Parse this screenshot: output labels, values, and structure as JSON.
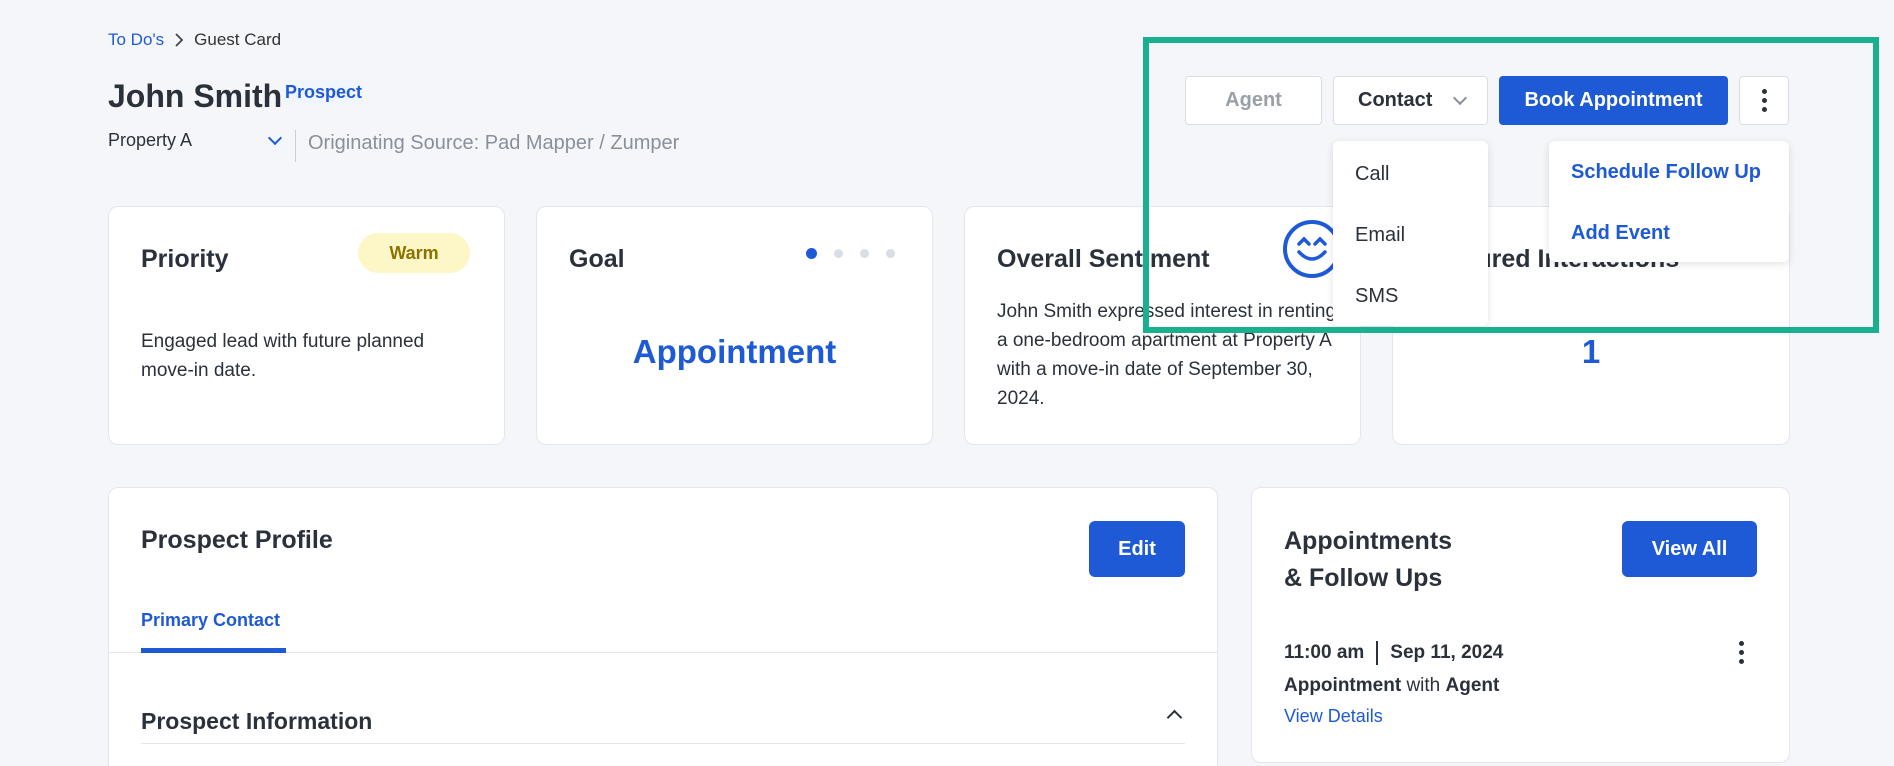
{
  "breadcrumb": {
    "parent": "To Do's",
    "current": "Guest Card"
  },
  "header": {
    "name": "John Smith",
    "status_badge": "Prospect",
    "property": "Property A",
    "originating_source": "Originating Source: Pad Mapper / Zumper"
  },
  "actions": {
    "agent": "Agent",
    "contact": "Contact",
    "book": "Book Appointment"
  },
  "contact_menu": {
    "items": [
      "Call",
      "Email",
      "SMS"
    ]
  },
  "more_menu": {
    "items": [
      "Schedule Follow Up",
      "Add Event"
    ]
  },
  "cards": {
    "priority": {
      "title": "Priority",
      "badge": "Warm",
      "body": "Engaged lead with future planned move-in date."
    },
    "goal": {
      "title": "Goal",
      "value": "Appointment",
      "steps_total": 4,
      "current_step": 1
    },
    "sentiment": {
      "title": "Overall Sentiment",
      "body": "John Smith expressed interest in renting a one-bedroom apartment at Property A with a move-in date of September 30, 2024."
    },
    "interactions": {
      "title": "Featured Interactions",
      "value": "1"
    }
  },
  "profile": {
    "title": "Prospect Profile",
    "edit": "Edit",
    "tab": "Primary Contact",
    "section": "Prospect Information"
  },
  "appointments": {
    "title_line1": "Appointments",
    "title_line2": "& Follow Ups",
    "view_all": "View All",
    "item": {
      "time": "11:00 am",
      "date": "Sep 11, 2024",
      "type": "Appointment",
      "with_word": "with",
      "with": "Agent",
      "link": "View Details"
    }
  },
  "colors": {
    "accent": "#1e5ad6",
    "highlight": "#18b08f",
    "warm_bg": "#fdf6c6",
    "warm_text": "#8c7300"
  }
}
